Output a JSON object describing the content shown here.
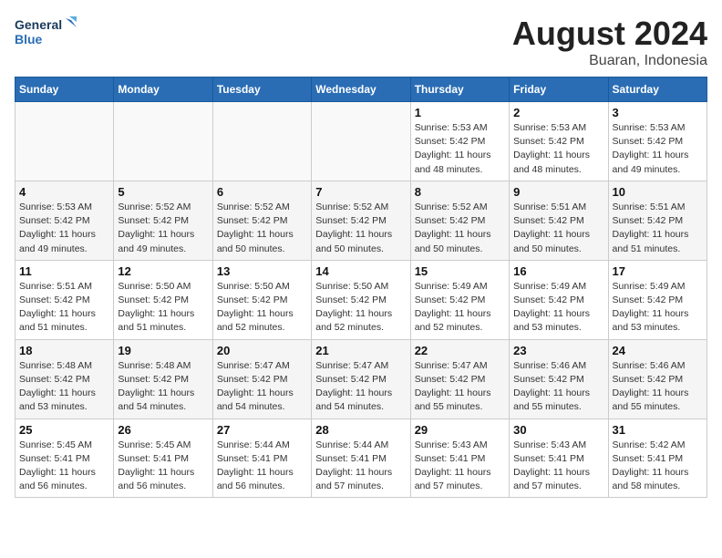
{
  "header": {
    "logo_line1": "General",
    "logo_line2": "Blue",
    "title": "August 2024",
    "subtitle": "Buaran, Indonesia"
  },
  "weekdays": [
    "Sunday",
    "Monday",
    "Tuesday",
    "Wednesday",
    "Thursday",
    "Friday",
    "Saturday"
  ],
  "weeks": [
    [
      {
        "day": "",
        "detail": ""
      },
      {
        "day": "",
        "detail": ""
      },
      {
        "day": "",
        "detail": ""
      },
      {
        "day": "",
        "detail": ""
      },
      {
        "day": "1",
        "detail": "Sunrise: 5:53 AM\nSunset: 5:42 PM\nDaylight: 11 hours\nand 48 minutes."
      },
      {
        "day": "2",
        "detail": "Sunrise: 5:53 AM\nSunset: 5:42 PM\nDaylight: 11 hours\nand 48 minutes."
      },
      {
        "day": "3",
        "detail": "Sunrise: 5:53 AM\nSunset: 5:42 PM\nDaylight: 11 hours\nand 49 minutes."
      }
    ],
    [
      {
        "day": "4",
        "detail": "Sunrise: 5:53 AM\nSunset: 5:42 PM\nDaylight: 11 hours\nand 49 minutes."
      },
      {
        "day": "5",
        "detail": "Sunrise: 5:52 AM\nSunset: 5:42 PM\nDaylight: 11 hours\nand 49 minutes."
      },
      {
        "day": "6",
        "detail": "Sunrise: 5:52 AM\nSunset: 5:42 PM\nDaylight: 11 hours\nand 50 minutes."
      },
      {
        "day": "7",
        "detail": "Sunrise: 5:52 AM\nSunset: 5:42 PM\nDaylight: 11 hours\nand 50 minutes."
      },
      {
        "day": "8",
        "detail": "Sunrise: 5:52 AM\nSunset: 5:42 PM\nDaylight: 11 hours\nand 50 minutes."
      },
      {
        "day": "9",
        "detail": "Sunrise: 5:51 AM\nSunset: 5:42 PM\nDaylight: 11 hours\nand 50 minutes."
      },
      {
        "day": "10",
        "detail": "Sunrise: 5:51 AM\nSunset: 5:42 PM\nDaylight: 11 hours\nand 51 minutes."
      }
    ],
    [
      {
        "day": "11",
        "detail": "Sunrise: 5:51 AM\nSunset: 5:42 PM\nDaylight: 11 hours\nand 51 minutes."
      },
      {
        "day": "12",
        "detail": "Sunrise: 5:50 AM\nSunset: 5:42 PM\nDaylight: 11 hours\nand 51 minutes."
      },
      {
        "day": "13",
        "detail": "Sunrise: 5:50 AM\nSunset: 5:42 PM\nDaylight: 11 hours\nand 52 minutes."
      },
      {
        "day": "14",
        "detail": "Sunrise: 5:50 AM\nSunset: 5:42 PM\nDaylight: 11 hours\nand 52 minutes."
      },
      {
        "day": "15",
        "detail": "Sunrise: 5:49 AM\nSunset: 5:42 PM\nDaylight: 11 hours\nand 52 minutes."
      },
      {
        "day": "16",
        "detail": "Sunrise: 5:49 AM\nSunset: 5:42 PM\nDaylight: 11 hours\nand 53 minutes."
      },
      {
        "day": "17",
        "detail": "Sunrise: 5:49 AM\nSunset: 5:42 PM\nDaylight: 11 hours\nand 53 minutes."
      }
    ],
    [
      {
        "day": "18",
        "detail": "Sunrise: 5:48 AM\nSunset: 5:42 PM\nDaylight: 11 hours\nand 53 minutes."
      },
      {
        "day": "19",
        "detail": "Sunrise: 5:48 AM\nSunset: 5:42 PM\nDaylight: 11 hours\nand 54 minutes."
      },
      {
        "day": "20",
        "detail": "Sunrise: 5:47 AM\nSunset: 5:42 PM\nDaylight: 11 hours\nand 54 minutes."
      },
      {
        "day": "21",
        "detail": "Sunrise: 5:47 AM\nSunset: 5:42 PM\nDaylight: 11 hours\nand 54 minutes."
      },
      {
        "day": "22",
        "detail": "Sunrise: 5:47 AM\nSunset: 5:42 PM\nDaylight: 11 hours\nand 55 minutes."
      },
      {
        "day": "23",
        "detail": "Sunrise: 5:46 AM\nSunset: 5:42 PM\nDaylight: 11 hours\nand 55 minutes."
      },
      {
        "day": "24",
        "detail": "Sunrise: 5:46 AM\nSunset: 5:42 PM\nDaylight: 11 hours\nand 55 minutes."
      }
    ],
    [
      {
        "day": "25",
        "detail": "Sunrise: 5:45 AM\nSunset: 5:41 PM\nDaylight: 11 hours\nand 56 minutes."
      },
      {
        "day": "26",
        "detail": "Sunrise: 5:45 AM\nSunset: 5:41 PM\nDaylight: 11 hours\nand 56 minutes."
      },
      {
        "day": "27",
        "detail": "Sunrise: 5:44 AM\nSunset: 5:41 PM\nDaylight: 11 hours\nand 56 minutes."
      },
      {
        "day": "28",
        "detail": "Sunrise: 5:44 AM\nSunset: 5:41 PM\nDaylight: 11 hours\nand 57 minutes."
      },
      {
        "day": "29",
        "detail": "Sunrise: 5:43 AM\nSunset: 5:41 PM\nDaylight: 11 hours\nand 57 minutes."
      },
      {
        "day": "30",
        "detail": "Sunrise: 5:43 AM\nSunset: 5:41 PM\nDaylight: 11 hours\nand 57 minutes."
      },
      {
        "day": "31",
        "detail": "Sunrise: 5:42 AM\nSunset: 5:41 PM\nDaylight: 11 hours\nand 58 minutes."
      }
    ]
  ]
}
